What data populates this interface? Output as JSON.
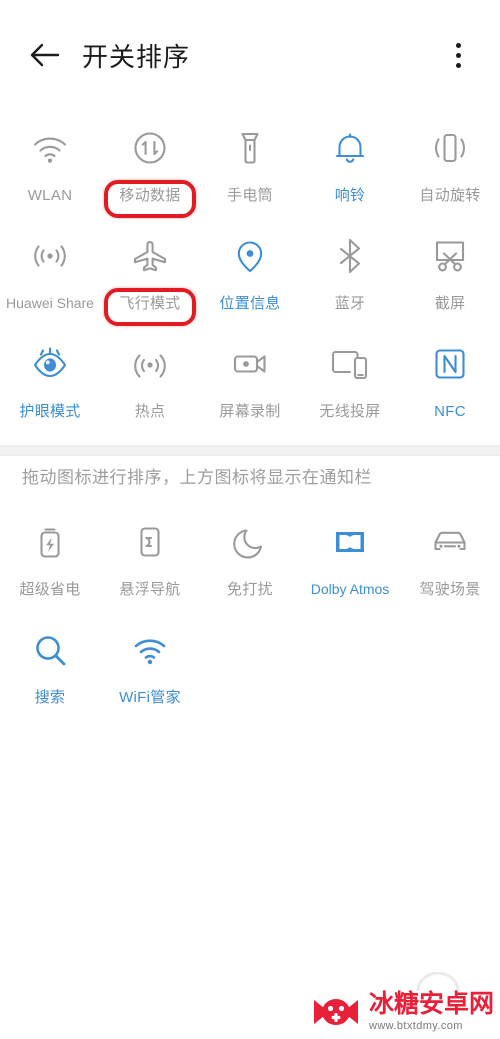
{
  "header": {
    "title": "开关排序",
    "back_icon": "back-arrow-icon",
    "menu_icon": "more-vertical-icon"
  },
  "hint": {
    "text": "拖动图标进行排序，上方图标将显示在通知栏"
  },
  "colors": {
    "active_blue": "#3d8ed4",
    "inactive_gray": "#9a9a9a",
    "annotation_red": "#e01b22",
    "divider_gray": "#f1f1f1",
    "title_black": "#1c1c1c"
  },
  "notification_panel_toggles": [
    {
      "label": "WLAN",
      "icon": "wifi-icon",
      "state": "inactive",
      "annotated": false
    },
    {
      "label": "移动数据",
      "icon": "mobile-data-icon",
      "state": "inactive",
      "annotated": true
    },
    {
      "label": "手电筒",
      "icon": "flashlight-icon",
      "state": "inactive",
      "annotated": false
    },
    {
      "label": "响铃",
      "icon": "bell-icon",
      "state": "active",
      "annotated": false
    },
    {
      "label": "自动旋转",
      "icon": "auto-rotate-icon",
      "state": "inactive",
      "annotated": false
    },
    {
      "label": "Huawei Share",
      "icon": "huawei-share-icon",
      "state": "inactive",
      "annotated": false
    },
    {
      "label": "飞行模式",
      "icon": "airplane-icon",
      "state": "inactive",
      "annotated": true
    },
    {
      "label": "位置信息",
      "icon": "location-pin-icon",
      "state": "active",
      "annotated": false
    },
    {
      "label": "蓝牙",
      "icon": "bluetooth-icon",
      "state": "inactive",
      "annotated": false
    },
    {
      "label": "截屏",
      "icon": "screenshot-icon",
      "state": "inactive",
      "annotated": false
    },
    {
      "label": "护眼模式",
      "icon": "eye-comfort-icon",
      "state": "active",
      "annotated": false
    },
    {
      "label": "热点",
      "icon": "hotspot-icon",
      "state": "inactive",
      "annotated": false
    },
    {
      "label": "屏幕录制",
      "icon": "screen-record-icon",
      "state": "inactive",
      "annotated": false
    },
    {
      "label": "无线投屏",
      "icon": "wireless-cast-icon",
      "state": "inactive",
      "annotated": false
    },
    {
      "label": "NFC",
      "icon": "nfc-icon",
      "state": "active",
      "annotated": false
    }
  ],
  "hidden_toggles": [
    {
      "label": "超级省电",
      "icon": "super-power-saving-icon",
      "state": "inactive"
    },
    {
      "label": "悬浮导航",
      "icon": "floating-nav-icon",
      "state": "inactive"
    },
    {
      "label": "免打扰",
      "icon": "do-not-disturb-icon",
      "state": "inactive"
    },
    {
      "label": "Dolby Atmos",
      "icon": "dolby-atmos-icon",
      "state": "active"
    },
    {
      "label": "驾驶场景",
      "icon": "driving-mode-icon",
      "state": "inactive"
    },
    {
      "label": "搜索",
      "icon": "search-icon",
      "state": "active"
    },
    {
      "label": "WiFi管家",
      "icon": "wifi-manager-icon",
      "state": "active"
    }
  ],
  "watermark": {
    "title": "冰糖安卓网",
    "url": "www.btxtdmy.com",
    "logo_icon": "candy-gamepad-logo-icon"
  }
}
